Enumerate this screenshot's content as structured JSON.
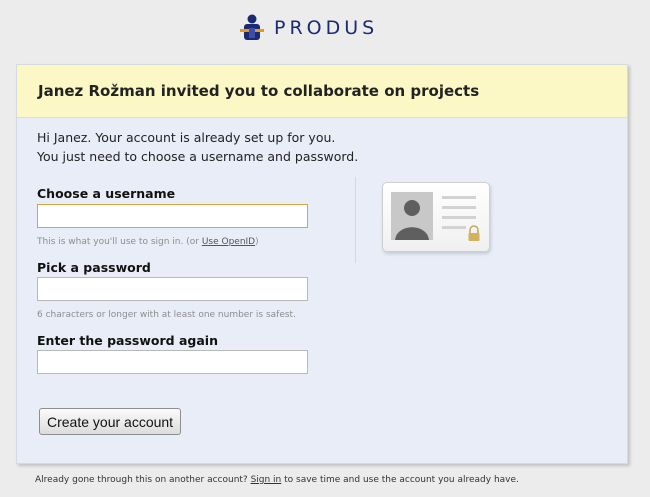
{
  "brand": {
    "name": "PRODUS",
    "logo_icon": "produs-logo-icon"
  },
  "header": {
    "title": "Janez Rožman invited you to collaborate on projects"
  },
  "intro": {
    "line1": "Hi Janez. Your account is already set up for you.",
    "line2": "You just need to choose a username and password."
  },
  "username": {
    "label": "Choose a username",
    "value": "",
    "hint_prefix": "This is what you'll use to sign in. (or ",
    "openid_link": "Use OpenID",
    "hint_suffix": ")"
  },
  "password": {
    "label": "Pick a password",
    "value": "",
    "hint": "6 characters or longer with at least one number is safest."
  },
  "password_again": {
    "label": "Enter the password again",
    "value": ""
  },
  "submit": {
    "label": "Create your account"
  },
  "footer": {
    "prefix": "Already gone through this on another account? ",
    "signin_link": "Sign in",
    "suffix": " to save time and use the account you already have."
  },
  "colors": {
    "header_bg": "#fbf8c5",
    "card_bg": "#e8edf7",
    "brand_text": "#1c2a72",
    "focus_border": "#d9a443"
  },
  "icons": [
    "produs-logo-icon",
    "id-card-icon",
    "padlock-icon"
  ]
}
